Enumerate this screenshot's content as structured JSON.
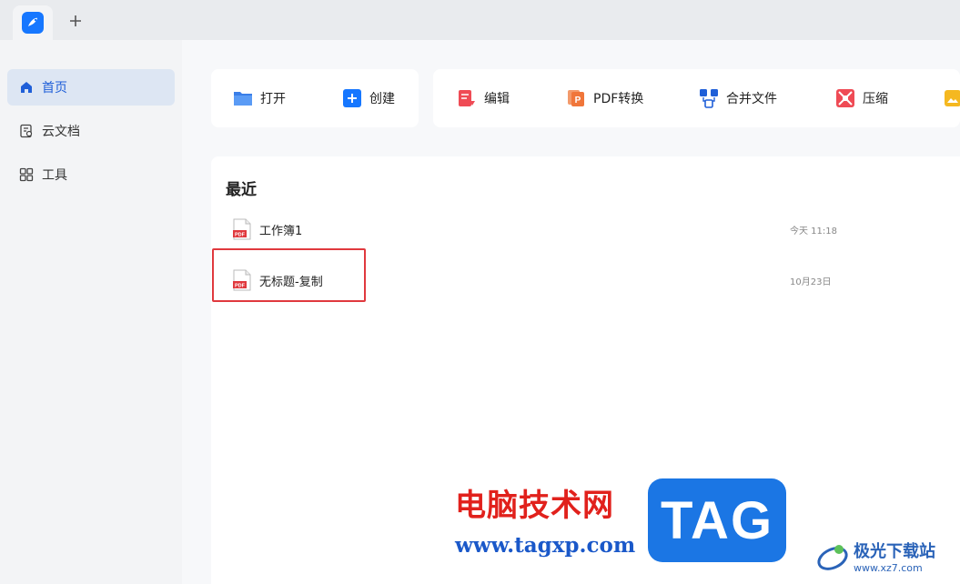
{
  "tabbar": {
    "new_tab_label": "+"
  },
  "sidebar": {
    "items": [
      {
        "label": "首页",
        "active": true
      },
      {
        "label": "云文档",
        "active": false
      },
      {
        "label": "工具",
        "active": false
      }
    ]
  },
  "toolbar": {
    "open_label": "打开",
    "create_label": "创建",
    "edit_label": "编辑",
    "pdf_convert_label": "PDF转换",
    "merge_label": "合并文件",
    "compress_label": "压缩"
  },
  "recent": {
    "title": "最近",
    "files": [
      {
        "name": "工作簿1",
        "date": "今天 11:18",
        "type_label": "PDF"
      },
      {
        "name": "无标题-复制",
        "date": "10月23日",
        "type_label": "PDF"
      }
    ]
  },
  "watermark": {
    "cn_text": "电脑技术网",
    "url": "www.tagxp.com",
    "tag": "TAG",
    "site_name": "极光下载站",
    "site_url": "www.xz7.com"
  },
  "colors": {
    "accent": "#1677ff",
    "highlight": "#e0393e",
    "pdf_red": "#e0393e"
  }
}
